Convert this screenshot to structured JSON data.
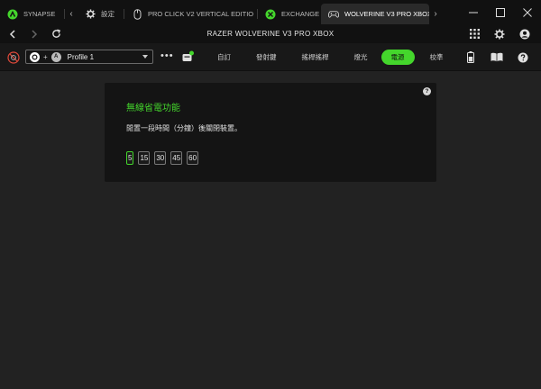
{
  "window": {
    "tabs": [
      {
        "label": "SYNAPSE",
        "icon": "razer-logo-icon"
      },
      {
        "label": "設定",
        "icon": "gear-icon"
      },
      {
        "label": "PRO CLICK V2 VERTICAL EDITIO",
        "icon": "mouse-icon"
      },
      {
        "label": "EXCHANGE",
        "icon": "exchange-icon"
      },
      {
        "label": "WOLVERINE V3 PRO XBOX",
        "icon": "gamepad-icon",
        "active": true
      }
    ],
    "controls": {
      "minimize": "—",
      "maximize": "☐",
      "close": "✕"
    }
  },
  "nav": {
    "device_title": "RAZER WOLVERINE V3 PRO XBOX"
  },
  "toolbar": {
    "profile": {
      "badge_b": "A",
      "plus": "+",
      "name": "Profile 1"
    },
    "more": "•••",
    "tabs": [
      {
        "label": "自訂",
        "active": false
      },
      {
        "label": "發射鍵",
        "active": false
      },
      {
        "label": "搖桿搖桿",
        "active": false
      },
      {
        "label": "燈光",
        "active": false
      },
      {
        "label": "電源",
        "active": true
      },
      {
        "label": "校準",
        "active": false
      }
    ]
  },
  "power": {
    "help": "?",
    "title": "無線省電功能",
    "description": "閒置一段時間（分鐘）後關閉裝置。",
    "options": [
      "5",
      "15",
      "30",
      "45",
      "60"
    ],
    "selected": "5"
  },
  "colors": {
    "accent": "#44d62c",
    "bg": "#222222",
    "panel": "#141414",
    "titlebar": "#111111"
  }
}
